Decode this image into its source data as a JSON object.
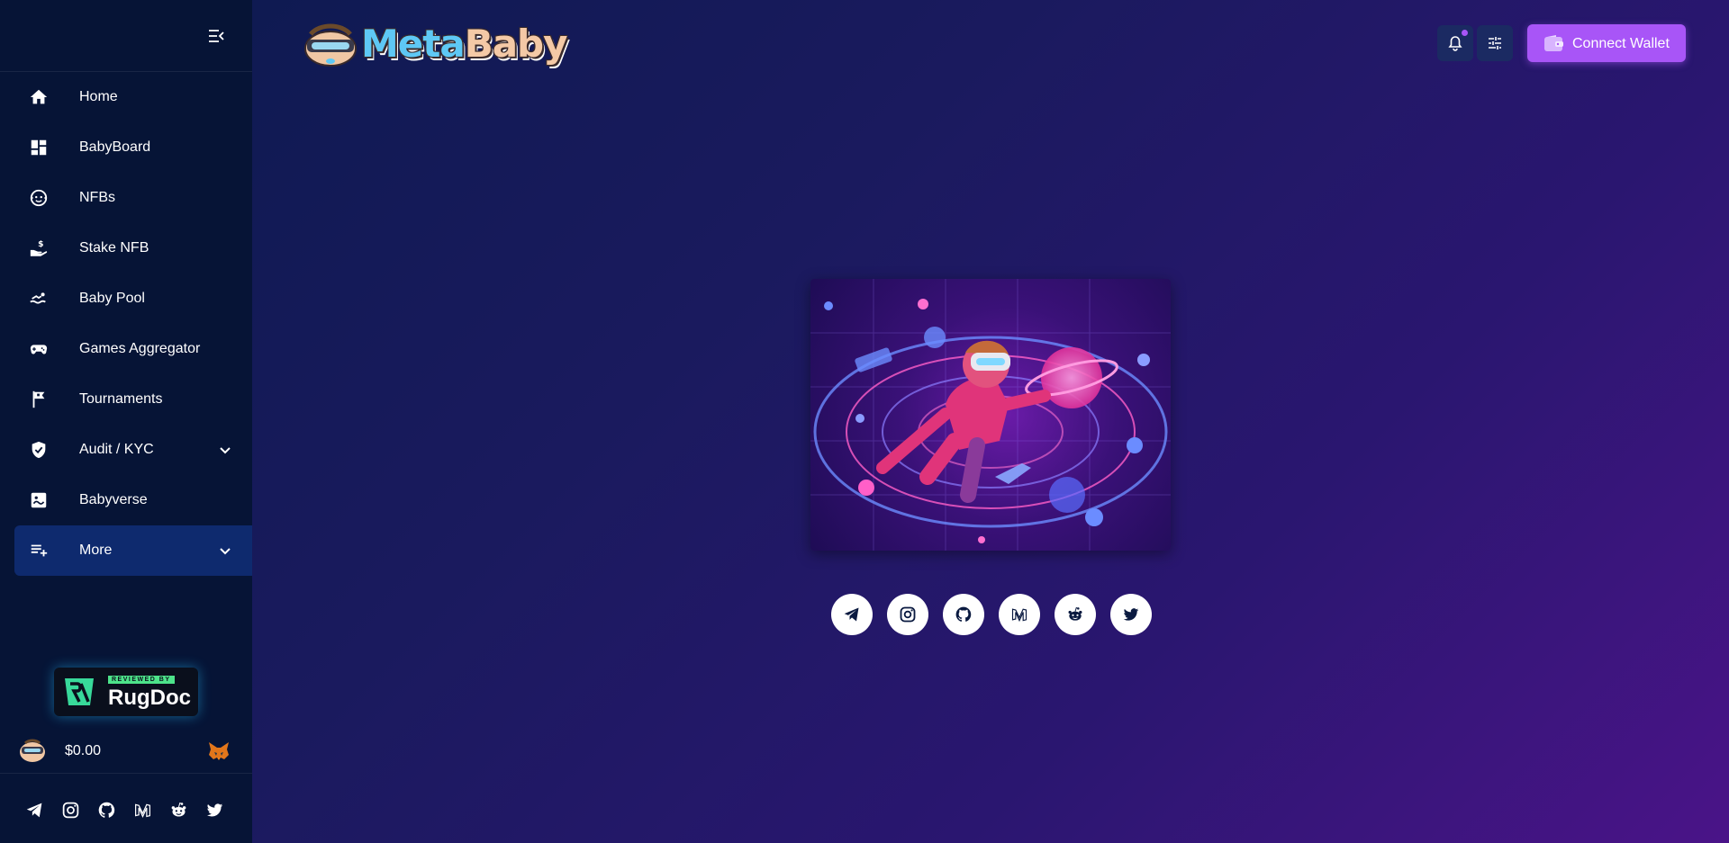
{
  "app": {
    "brand_meta": "Meta",
    "brand_baby": "Baby"
  },
  "sidebar": {
    "items": [
      {
        "label": "Home",
        "icon": "home-icon"
      },
      {
        "label": "BabyBoard",
        "icon": "dashboard-icon"
      },
      {
        "label": "NFBs",
        "icon": "baby-face-icon"
      },
      {
        "label": "Stake NFB",
        "icon": "stake-hand-icon"
      },
      {
        "label": "Baby Pool",
        "icon": "pool-swim-icon"
      },
      {
        "label": "Games Aggregator",
        "icon": "gamepad-icon"
      },
      {
        "label": "Tournaments",
        "icon": "flag-icon"
      },
      {
        "label": "Audit / KYC",
        "icon": "shield-check-icon",
        "expandable": true
      },
      {
        "label": "Babyverse",
        "icon": "babyverse-icon"
      },
      {
        "label": "More",
        "icon": "playlist-add-icon",
        "expandable": true,
        "active": true
      }
    ],
    "rugdoc_badge": {
      "top": "REVIEWED BY",
      "name": "RugDoc"
    },
    "token_price": "$0.00"
  },
  "header": {
    "connect_label": "Connect Wallet",
    "notification_unread": true
  },
  "socials": [
    "telegram-icon",
    "instagram-icon",
    "github-icon",
    "medium-icon",
    "reddit-icon",
    "twitter-icon"
  ],
  "colors": {
    "sidebar_bg": "#061436",
    "accent": "#a855f7",
    "active_item": "#0e2a6e"
  }
}
